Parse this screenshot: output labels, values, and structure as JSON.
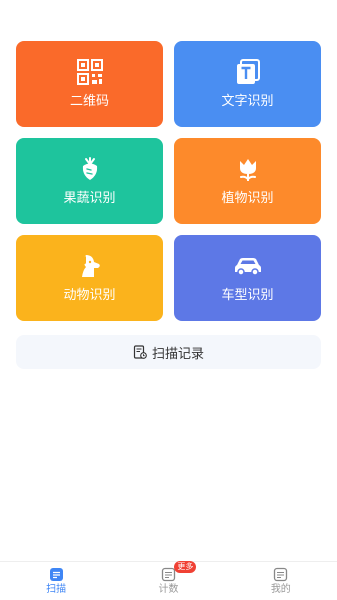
{
  "tiles": [
    {
      "label": "二维码",
      "color": "#fa6a2a",
      "icon": "qr-code-icon"
    },
    {
      "label": "文字识别",
      "color": "#4a8ef2",
      "icon": "text-recognition-icon"
    },
    {
      "label": "果蔬识别",
      "color": "#1ec49d",
      "icon": "vegetable-icon"
    },
    {
      "label": "植物识别",
      "color": "#fd8a2b",
      "icon": "flower-icon"
    },
    {
      "label": "动物识别",
      "color": "#fbb31c",
      "icon": "dog-icon"
    },
    {
      "label": "车型识别",
      "color": "#5d78e6",
      "icon": "car-icon"
    }
  ],
  "history": {
    "label": "扫描记录",
    "icon": "history-doc-icon"
  },
  "tabbar": {
    "tabs": [
      {
        "label": "扫描",
        "icon": "scan-tab-icon",
        "active": true
      },
      {
        "label": "计数",
        "icon": "count-tab-icon",
        "active": false,
        "badge": "更多"
      },
      {
        "label": "我的",
        "icon": "profile-tab-icon",
        "active": false
      }
    ],
    "active_color": "#3f86f5",
    "inactive_color": "#999999"
  }
}
